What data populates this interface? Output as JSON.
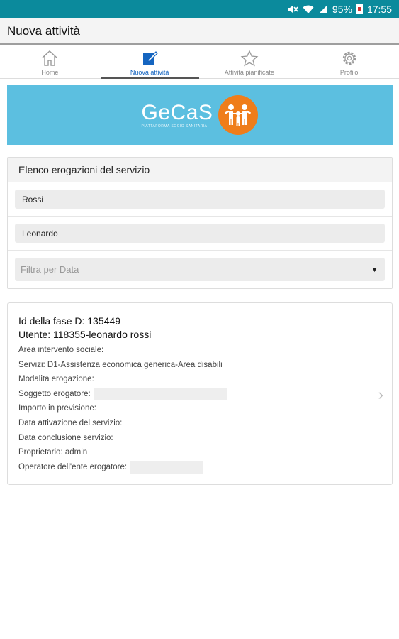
{
  "status_bar": {
    "battery": "95%",
    "time": "17:55",
    "icons": [
      "mute-icon",
      "wifi-icon",
      "signal-icon",
      "battery-icon"
    ]
  },
  "app_bar": {
    "title": "Nuova attività"
  },
  "tabs": [
    {
      "label": "Home",
      "icon": "home-icon",
      "active": false
    },
    {
      "label": "Nuova attività",
      "icon": "edit-icon",
      "active": true
    },
    {
      "label": "Attività pianificate",
      "icon": "star-icon",
      "active": false
    },
    {
      "label": "Profilo",
      "icon": "gear-icon",
      "active": false
    }
  ],
  "banner": {
    "brand_name": "GeCaS",
    "brand_tagline": "PIATTAFORMA SOCIO SANITARIA",
    "brand_color": "#5cbfe0",
    "logo_color": "#ef7d1a"
  },
  "filter": {
    "header": "Elenco erogazioni del servizio",
    "surname_value": "Rossi",
    "name_value": "Leonardo",
    "date_placeholder": "Filtra per Data"
  },
  "result": {
    "title_line1": "Id della fase D: 135449",
    "title_line2": "Utente: 118355-leonardo rossi",
    "area": "Area intervento sociale:",
    "servizi": "Servizi: D1-Assistenza economica generica-Area disabili",
    "modalita": "Modalita erogazione:",
    "soggetto": "Soggetto erogatore:",
    "importo": "Importo in previsione:",
    "data_attivazione": "Data attivazione del servizio:",
    "data_conclusione": "Data conclusione servizio:",
    "proprietario": "Proprietario: admin",
    "operatore": "Operatore dell'ente erogatore:"
  },
  "colors": {
    "status_bar": "#0b8a9c",
    "active_tab": "#1565c0"
  }
}
